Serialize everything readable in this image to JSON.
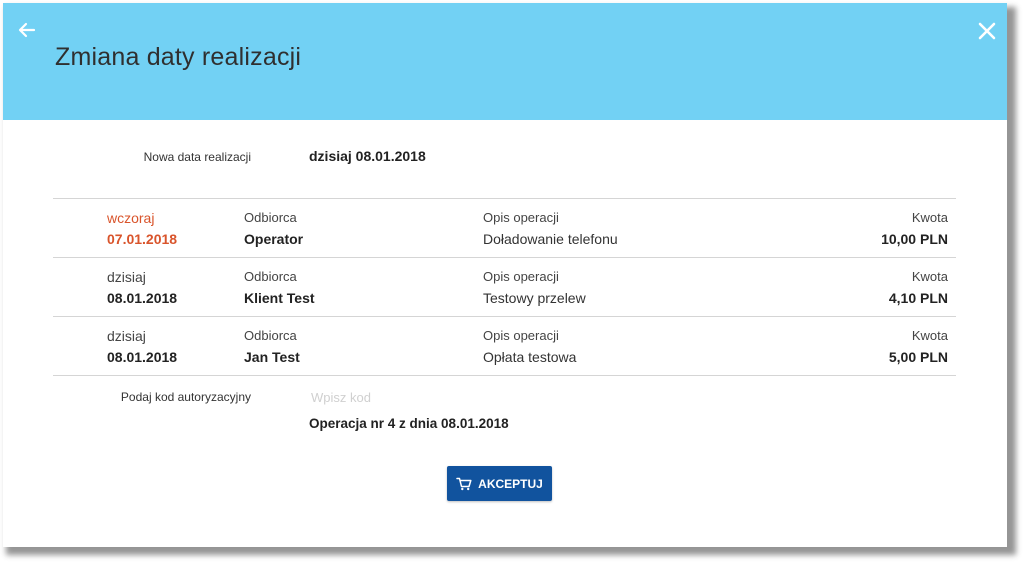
{
  "dialog": {
    "title": "Zmiana daty realizacji",
    "back_icon": "arrow-left-icon",
    "close_icon": "close-icon",
    "header_color": "#72d1f4"
  },
  "new_date": {
    "label": "Nowa data realizacji",
    "value": "dzisiaj 08.01.2018"
  },
  "operations": [
    {
      "day": "wczoraj",
      "date": "07.01.2018",
      "highlight": true,
      "recipient_label": "Odbiorca",
      "recipient": "Operator",
      "desc_label": "Opis operacji",
      "desc": "Doładowanie telefonu",
      "amount_label": "Kwota",
      "amount": "10,00 PLN"
    },
    {
      "day": "dzisiaj",
      "date": "08.01.2018",
      "highlight": false,
      "recipient_label": "Odbiorca",
      "recipient": "Klient Test",
      "desc_label": "Opis operacji",
      "desc": "Testowy przelew",
      "amount_label": "Kwota",
      "amount": "4,10 PLN"
    },
    {
      "day": "dzisiaj",
      "date": "08.01.2018",
      "highlight": false,
      "recipient_label": "Odbiorca",
      "recipient": "Jan Test",
      "desc_label": "Opis operacji",
      "desc": "Opłata testowa",
      "amount_label": "Kwota",
      "amount": "5,00 PLN"
    }
  ],
  "auth": {
    "label": "Podaj kod autoryzacyjny",
    "placeholder": "Wpisz kod",
    "operation_info": "Operacja nr 4 z dnia 08.01.2018"
  },
  "accept_button": {
    "label": "AKCEPTUJ",
    "icon": "cart-icon",
    "color": "#11539e"
  },
  "colors": {
    "highlight": "#d9542b"
  }
}
